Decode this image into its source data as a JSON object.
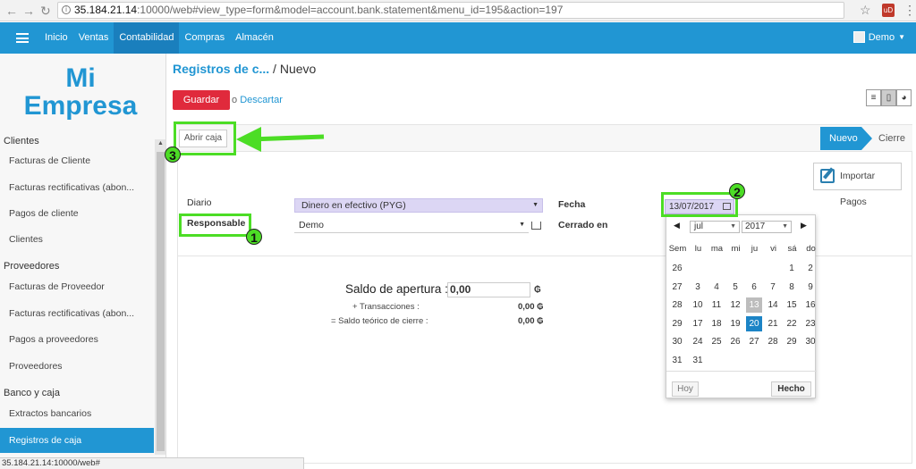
{
  "browser": {
    "url_host": "35.184.21.14",
    "url_rest": ":10000/web#view_type=form&model=account.bank.statement&menu_id=195&action=197",
    "status_url": "35.184.21.14:10000/web#"
  },
  "topbar": {
    "menu": [
      "Inicio",
      "Ventas",
      "Contabilidad",
      "Compras",
      "Almacén"
    ],
    "active_menu": "Contabilidad",
    "user": "Demo"
  },
  "sidebar": {
    "logo_line1": "Mi",
    "logo_line2": "Empresa",
    "sections": [
      {
        "title": "Clientes",
        "items": [
          "Facturas de Cliente",
          "Facturas rectificativas (abon...",
          "Pagos de cliente",
          "Clientes"
        ]
      },
      {
        "title": "Proveedores",
        "items": [
          "Facturas de Proveedor",
          "Facturas rectificativas (abon...",
          "Pagos a proveedores",
          "Proveedores"
        ]
      },
      {
        "title": "Banco y caja",
        "items": [
          "Extractos bancarios",
          "Registros de caja"
        ]
      }
    ],
    "active_item": "Registros de caja"
  },
  "breadcrumb": {
    "parent": "Registros de c...",
    "separator": "/",
    "current": "Nuevo"
  },
  "actions": {
    "save": "Guardar",
    "or": "o",
    "discard": "Descartar"
  },
  "statusbar": {
    "open_button": "Abrir caja",
    "states": [
      "Nuevo",
      "Cierre"
    ],
    "active_state": "Nuevo"
  },
  "form": {
    "import_button": "Importar Pagos",
    "diario_label": "Diario",
    "diario_value": "Dinero en efectivo (PYG)",
    "responsable_label": "Responsable",
    "responsable_value": "Demo",
    "fecha_label": "Fecha",
    "fecha_value": "13/07/2017",
    "cerrado_label": "Cerrado en",
    "saldo_label": "Saldo de apertura :",
    "saldo_value": "0,00",
    "currency": "₲",
    "transacciones_label": "+ Transacciones :",
    "transacciones_value": "0,00 ₲",
    "teorico_label": "= Saldo teórico de cierre :",
    "teorico_value": "0,00 ₲"
  },
  "datepicker": {
    "prev": "◀",
    "next": "▶",
    "month": "jul",
    "year": "2017",
    "headers": [
      "Sem",
      "lu",
      "ma",
      "mi",
      "ju",
      "vi",
      "sá",
      "do"
    ],
    "weeks": [
      [
        "26",
        "",
        "",
        "",
        "",
        "",
        "1",
        "2"
      ],
      [
        "27",
        "3",
        "4",
        "5",
        "6",
        "7",
        "8",
        "9"
      ],
      [
        "28",
        "10",
        "11",
        "12",
        "13",
        "14",
        "15",
        "16"
      ],
      [
        "29",
        "17",
        "18",
        "19",
        "20",
        "21",
        "22",
        "23"
      ],
      [
        "30",
        "24",
        "25",
        "26",
        "27",
        "28",
        "29",
        "30"
      ],
      [
        "31",
        "31",
        "",
        "",
        "",
        "",
        "",
        ""
      ]
    ],
    "today": "13",
    "selected": "20",
    "today_button": "Hoy",
    "done_button": "Hecho"
  },
  "annotations": {
    "one": "1",
    "two": "2",
    "three": "3",
    "color": "#4cdd25"
  },
  "colors": {
    "primary": "#2196d3",
    "save": "#e02a3c",
    "highlight": "#dcd6f4"
  }
}
